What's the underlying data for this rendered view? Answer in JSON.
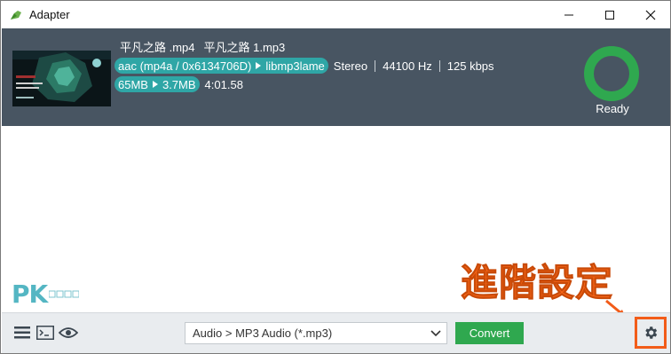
{
  "window": {
    "title": "Adapter"
  },
  "item": {
    "source_file": "平凡之路 .mp4",
    "output_file": "平凡之路 1.mp3",
    "source_codec": "aac (mp4a / 0x6134706D)",
    "target_codec": "libmp3lame",
    "channels": "Stereo",
    "sample_rate": "44100 Hz",
    "bitrate": "125 kbps",
    "source_size": "65MB",
    "target_size": "3.7MB",
    "duration": "4:01.58",
    "status": "Ready",
    "status_color": "#2fa84f"
  },
  "overlay": {
    "label": "進階設定",
    "color": "#ff6a1a"
  },
  "watermark": {
    "brand": "PK"
  },
  "toolbar": {
    "preset": "Audio > MP3 Audio (*.mp3)",
    "convert_label": "Convert",
    "accent": "#2fa84f"
  },
  "icons": {
    "list": "hamburger-menu-icon",
    "terminal": "terminal-icon",
    "preview": "eye-icon",
    "settings": "gear-icon"
  }
}
